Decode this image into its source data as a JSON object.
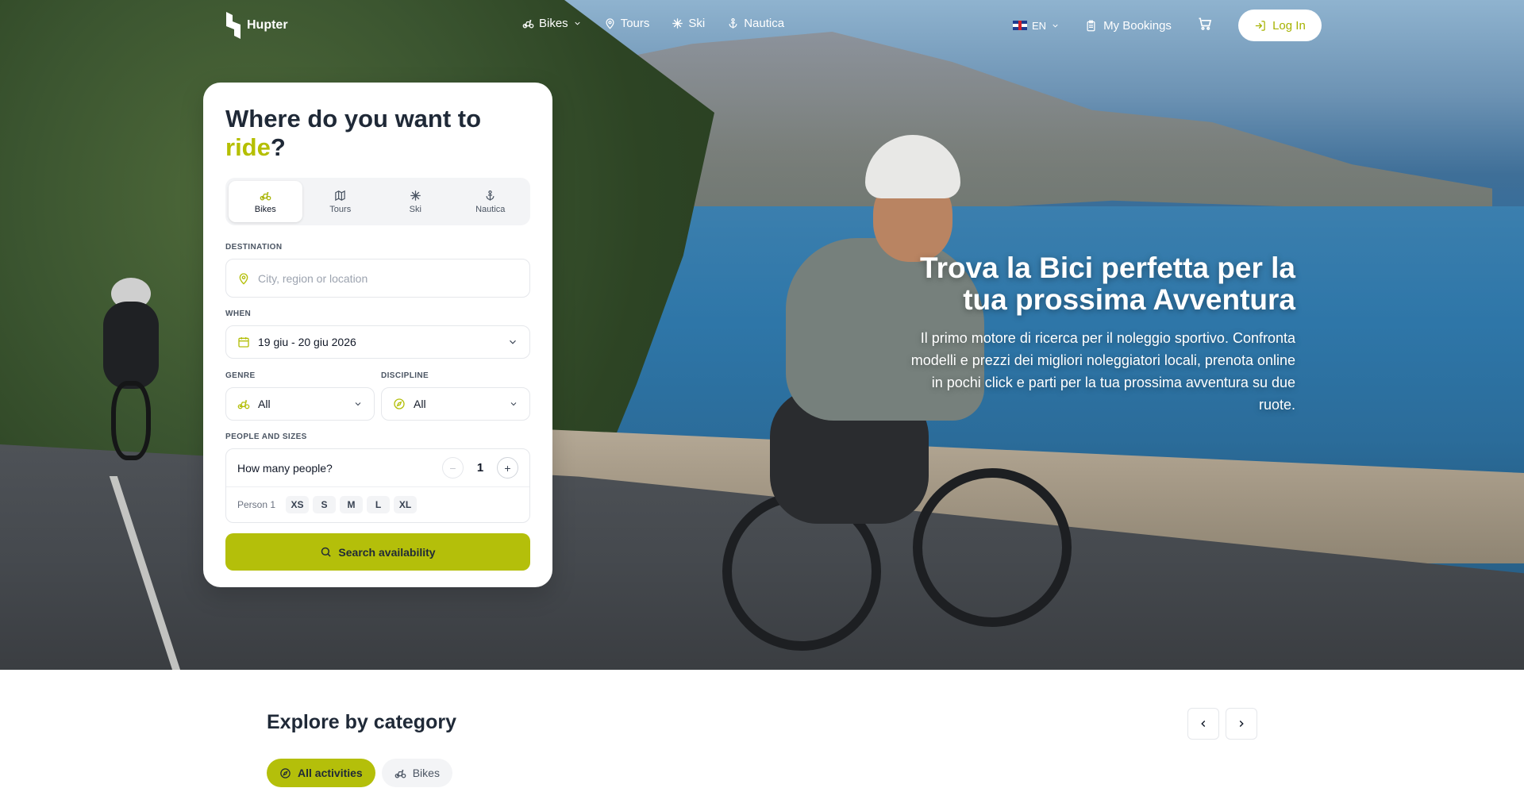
{
  "brand": {
    "name": "Hupter"
  },
  "nav": {
    "links": [
      {
        "label": "Bikes",
        "icon": "bike-icon",
        "has_dropdown": true
      },
      {
        "label": "Tours",
        "icon": "map-pin-icon"
      },
      {
        "label": "Ski",
        "icon": "snowflake-icon"
      },
      {
        "label": "Nautica",
        "icon": "anchor-icon"
      }
    ],
    "language": "EN",
    "bookings_label": "My Bookings",
    "login_label": "Log In"
  },
  "search_card": {
    "title_prefix": "Where do you want to",
    "title_accent": "ride",
    "title_suffix": "?",
    "tabs": [
      {
        "label": "Bikes",
        "icon": "bike-icon",
        "active": true
      },
      {
        "label": "Tours",
        "icon": "map-icon"
      },
      {
        "label": "Ski",
        "icon": "snowflake-icon"
      },
      {
        "label": "Nautica",
        "icon": "anchor-icon"
      }
    ],
    "destination": {
      "label": "DESTINATION",
      "placeholder": "City, region or location",
      "value": ""
    },
    "when": {
      "label": "WHEN",
      "value": "19 giu - 20 giu 2026"
    },
    "genre": {
      "label": "GENRE",
      "value": "All"
    },
    "discipline": {
      "label": "DISCIPLINE",
      "value": "All"
    },
    "people": {
      "label": "PEOPLE AND SIZES",
      "question": "How many people?",
      "count": "1",
      "minus": "−",
      "plus": "+",
      "person_label": "Person 1",
      "sizes": [
        "XS",
        "S",
        "M",
        "L",
        "XL"
      ]
    },
    "search_button": "Search availability"
  },
  "hero": {
    "title": "Trova la Bici perfetta per la tua prossima Avventura",
    "subtitle": "Il primo motore di ricerca per il noleggio sportivo. Confronta modelli e prezzi dei migliori noleggiatori locali, prenota online in pochi click e parti per la tua prossima avventura su due ruote."
  },
  "explore": {
    "title": "Explore by category",
    "chips": [
      {
        "label": "All activities",
        "icon": "compass-icon",
        "active": true
      },
      {
        "label": "Bikes",
        "icon": "bike-icon",
        "active": false
      }
    ]
  },
  "colors": {
    "accent": "#b4bf0a",
    "accent_text": "#a6b200",
    "text": "#1f2937"
  }
}
